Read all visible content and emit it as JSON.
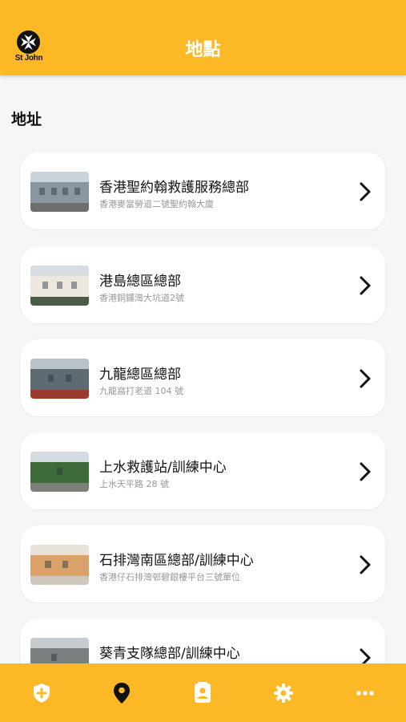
{
  "app": {
    "logo_text": "St John",
    "title": "地點"
  },
  "section": {
    "title": "地址"
  },
  "locations": [
    {
      "name": "香港聖約翰救護服務總部",
      "address": "香港麥當勞道二號聖約翰大廈"
    },
    {
      "name": "港島總區總部",
      "address": "香港銅鑼灣大坑道2號"
    },
    {
      "name": "九龍總區總部",
      "address": "九龍窩打老道 104 號"
    },
    {
      "name": "上水救護站/訓練中心",
      "address": "上水天平路 28 號"
    },
    {
      "name": "石排灣南區總部/訓練中心",
      "address": "香港仔石排灣邨碧銀樓平台三號單位"
    },
    {
      "name": "葵青支隊總部/訓練中心",
      "address": ""
    }
  ],
  "tabs": [
    {
      "icon": "shield-plus-icon",
      "active": false
    },
    {
      "icon": "map-pin-icon",
      "active": true
    },
    {
      "icon": "contact-card-icon",
      "active": false
    },
    {
      "icon": "gear-icon",
      "active": false
    },
    {
      "icon": "more-dots-icon",
      "active": false
    }
  ],
  "colors": {
    "accent": "#fdb925",
    "background": "#f6f6f6",
    "card": "#ffffff",
    "tab_active": "#111111",
    "tab_inactive": "#ffffff"
  }
}
